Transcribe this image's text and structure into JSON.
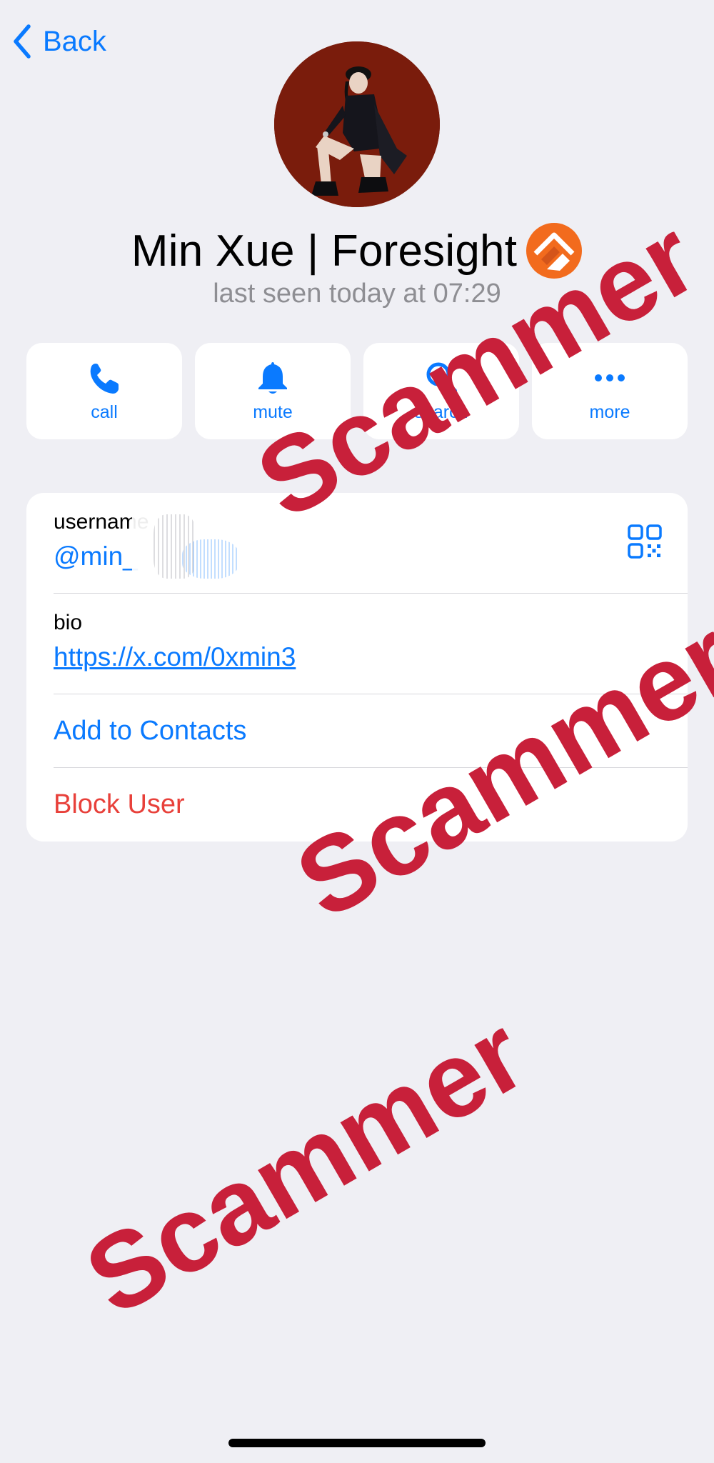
{
  "nav": {
    "back_label": "Back"
  },
  "profile": {
    "name": "Min Xue | Foresight",
    "last_seen": "last seen today at 07:29"
  },
  "actions": [
    {
      "label": "call",
      "icon": "phone-icon"
    },
    {
      "label": "mute",
      "icon": "bell-icon"
    },
    {
      "label": "search",
      "icon": "search-icon"
    },
    {
      "label": "more",
      "icon": "more-icon"
    }
  ],
  "info": {
    "username_label": "username",
    "username_value": "@min_",
    "bio_label": "bio",
    "bio_value": "https://x.com/0xmin3",
    "add_contact": "Add to Contacts",
    "block_user": "Block User"
  },
  "watermarks": [
    "Scammer",
    "Scammer",
    "Scammer"
  ],
  "colors": {
    "accent": "#0a7aff",
    "destructive": "#e8403a",
    "watermark": "#c8203a",
    "badge": "#f26b1d"
  }
}
